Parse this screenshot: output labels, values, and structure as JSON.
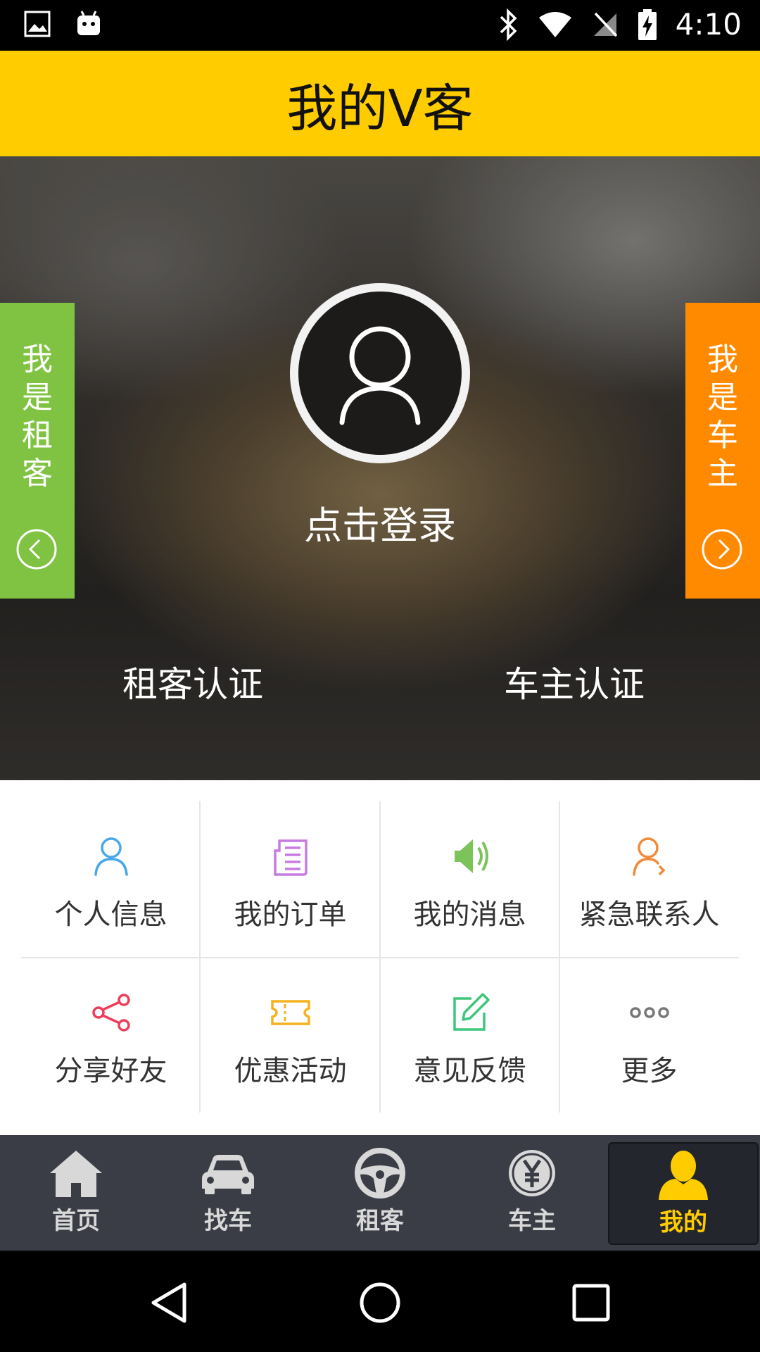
{
  "status_bar": {
    "time": "4:10",
    "left_icons": [
      "gallery-icon",
      "android-icon"
    ],
    "right_icons": [
      "bluetooth-icon",
      "wifi-icon",
      "no-sim-icon",
      "battery-charging-icon"
    ]
  },
  "header": {
    "title": "我的V客"
  },
  "hero": {
    "login_text": "点击登录",
    "left_tab": {
      "label": "我是租客",
      "icon": "chevron-left-circle-icon",
      "color": "#80c342"
    },
    "right_tab": {
      "label": "我是车主",
      "icon": "chevron-right-circle-icon",
      "color": "#ff8a00"
    },
    "tenant_cert": "租客认证",
    "owner_cert": "车主认证"
  },
  "menu": {
    "items": [
      {
        "label": "个人信息",
        "icon": "person-icon",
        "color": "#4aa8e8"
      },
      {
        "label": "我的订单",
        "icon": "order-list-icon",
        "color": "#c77be0"
      },
      {
        "label": "我的消息",
        "icon": "speaker-icon",
        "color": "#7cc35a"
      },
      {
        "label": "紧急联系人",
        "icon": "emergency-contact-icon",
        "color": "#f28a3c"
      },
      {
        "label": "分享好友",
        "icon": "share-icon",
        "color": "#ee3d5a"
      },
      {
        "label": "优惠活动",
        "icon": "coupon-icon",
        "color": "#f5b21f"
      },
      {
        "label": "意见反馈",
        "icon": "edit-feedback-icon",
        "color": "#3ec77b"
      },
      {
        "label": "更多",
        "icon": "more-dots-icon",
        "color": "#777777"
      }
    ]
  },
  "bottom_nav": {
    "items": [
      {
        "label": "首页",
        "icon": "home-icon"
      },
      {
        "label": "找车",
        "icon": "car-icon"
      },
      {
        "label": "租客",
        "icon": "steering-wheel-icon"
      },
      {
        "label": "车主",
        "icon": "yuan-coin-icon"
      },
      {
        "label": "我的",
        "icon": "user-silhouette-icon",
        "active": true
      }
    ],
    "active_color": "#ffcc00"
  },
  "system_nav": [
    "back-icon",
    "home-circle-icon",
    "recents-icon"
  ]
}
